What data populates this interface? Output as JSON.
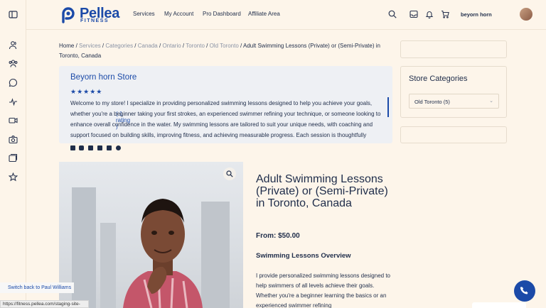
{
  "brand": {
    "name": "Pellea",
    "sub": "FITNESS",
    "color": "#1b4aa8"
  },
  "nav": [
    "Services",
    "My Account",
    "Pro Dashboard",
    "Affiliate Area"
  ],
  "user": {
    "name": "beyorn horn"
  },
  "sidebar_icons": [
    "panel-icon",
    "users-icon",
    "group-icon",
    "chat-icon",
    "activity-icon",
    "video-icon",
    "camera-icon",
    "gallery-icon",
    "star-icon"
  ],
  "breadcrumb": {
    "home": "Home",
    "sep": " / ",
    "links": [
      "Services",
      "Categories",
      "Canada",
      "Ontario",
      "Toronto",
      "Old Toronto"
    ],
    "current": "Adult Swimming Lessons (Private) or (Semi-Private) in Toronto, Canada"
  },
  "store": {
    "title": "Beyorn horn Store",
    "stars": "★★★★★",
    "rating": "( 1 rating )",
    "description": "Welcome to my store! I specialize in providing personalized swimming lessons designed to help you achieve your goals, whether you're a beginner taking your first strokes, an experienced swimmer refining your technique, or someone looking to enhance overall confidence in the water. My swimming lessons are tailored to suit your unique needs, with coaching and support focused on building skills, improving fitness, and achieving measurable progress. Each session is thoughtfully structured to ensure a safe, supportive, and results-driven experience. Conveniently"
  },
  "product": {
    "title": "Adult Swimming Lessons (Private) or (Semi-Private) in Toronto, Canada",
    "price": "From: $50.00",
    "overview": "Swimming Lessons Overview",
    "description": "I provide personalized swimming lessons designed to help swimmers of all levels achieve their goals. Whether you're a beginner learning the basics or an experienced swimmer refining"
  },
  "store_categories": {
    "title": "Store Categories",
    "selected": "Old Toronto  (5)"
  },
  "switch_back": "Switch back to Paul Williams",
  "status_url": "https://fitness.pellea.com/staging-site-"
}
